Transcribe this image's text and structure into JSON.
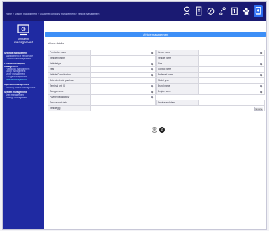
{
  "breadcrumb": "Home > System management > Customer company management > Vehicle management",
  "topbar": {
    "icons": [
      "user-location-icon",
      "document-icon",
      "compass-icon",
      "route-icon",
      "export-icon",
      "group-icon",
      "system-icon"
    ]
  },
  "sidebar": {
    "system_label_line1": "System",
    "system_label_line2": "management",
    "items": [
      {
        "label": "Settings management",
        "level": 1,
        "active": false
      },
      {
        "label": "Management of vehicle use",
        "level": 2,
        "active": false
      },
      {
        "label": "Control unit management",
        "level": 2,
        "active": false
      },
      {
        "label": "Customer company",
        "level": 1,
        "active": false
      },
      {
        "label": "management",
        "level": 1,
        "active": false
      },
      {
        "label": "Fuel Block management",
        "level": 2,
        "active": false
      },
      {
        "label": "Group management",
        "level": 2,
        "active": false
      },
      {
        "label": "Driver management",
        "level": 2,
        "active": false
      },
      {
        "label": "Garage management",
        "level": 2,
        "active": false
      },
      {
        "label": "Vehicle management",
        "level": 2,
        "active": true
      },
      {
        "label": "Operation management",
        "level": 1,
        "active": false
      },
      {
        "label": "Working volume management",
        "level": 2,
        "active": false
      },
      {
        "label": "System management",
        "level": 1,
        "active": false
      },
      {
        "label": "User management",
        "level": 2,
        "active": false
      },
      {
        "label": "Settings management",
        "level": 2,
        "active": false
      }
    ]
  },
  "main": {
    "title": "Vehicle management",
    "section_title": "Vehicle details",
    "rows": [
      {
        "left": {
          "label": "Primfuelan name",
          "dropdown": true
        },
        "right": {
          "label": "Group name",
          "dropdown": true
        }
      },
      {
        "left": {
          "label": "Vehicle number",
          "dropdown": false
        },
        "right": {
          "label": "Vehicle name",
          "dropdown": false
        }
      },
      {
        "left": {
          "label": "Vehicle type",
          "dropdown": true
        },
        "right": {
          "label": "Size",
          "dropdown": true
        }
      },
      {
        "left": {
          "label": "Year",
          "dropdown": true
        },
        "right": {
          "label": "Control name",
          "dropdown": false
        }
      },
      {
        "left": {
          "label": "Vehicle Classification",
          "dropdown": true
        },
        "right": {
          "label": "Preferred name",
          "dropdown": true
        }
      },
      {
        "left": {
          "label": "Date of vehicle purchase",
          "dropdown": false
        },
        "right": {
          "label": "Model year",
          "dropdown": false
        }
      },
      {
        "left": {
          "label": "Terminal unit ID",
          "dropdown": true
        },
        "right": {
          "label": "Brand name",
          "dropdown": true
        }
      },
      {
        "left": {
          "label": "Garage name",
          "dropdown": true
        },
        "right": {
          "label": "Engine name",
          "dropdown": true
        }
      },
      {
        "left": {
          "label": "Payment availability",
          "dropdown": true
        },
        "right": null
      },
      {
        "left": {
          "label": "Service start date",
          "dropdown": false
        },
        "right": {
          "label": "Service end date",
          "dropdown": false
        }
      }
    ],
    "image_row": {
      "label": "Vehicle jpg",
      "browse_label": "Browse"
    },
    "actions": {
      "save": "⊕",
      "cancel": "⊘"
    }
  },
  "colors": {
    "topbar": "#1a1a72",
    "sidebar": "#1f2aa2",
    "accent": "#3d8ff7",
    "active_nav": "#58e0ff"
  }
}
